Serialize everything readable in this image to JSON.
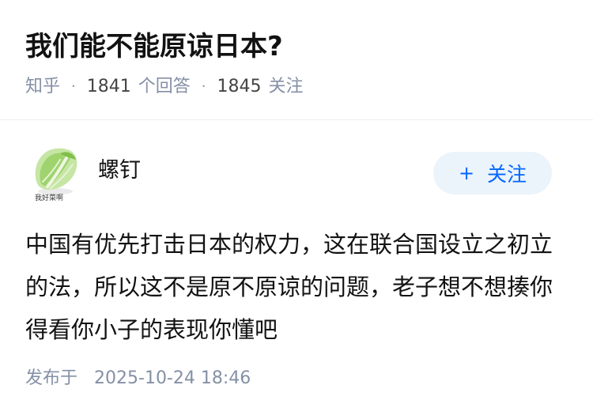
{
  "question": {
    "title": "我们能不能原谅日本?",
    "source": "知乎",
    "answer_count": "1841",
    "answer_label": "个回答",
    "follower_count": "1845",
    "follower_label": "关注",
    "separator": "·"
  },
  "answer": {
    "author": {
      "name": "螺钉",
      "avatar_icon": "cabbage-icon",
      "avatar_caption": "我好菜啊"
    },
    "follow_button": {
      "icon": "+",
      "label": "关注",
      "color": "#0066ff",
      "background": "#ebf3fb"
    },
    "content": "中国有优先打击日本的权力，这在联合国设立之初立的法，所以这不是原不原谅的问题，老子想不想揍你得看你小子的表现你懂吧",
    "published_label": "发布于",
    "published_time": "2025-10-24 18:46"
  },
  "colors": {
    "text": "#121212",
    "meta": "#8590a6"
  }
}
